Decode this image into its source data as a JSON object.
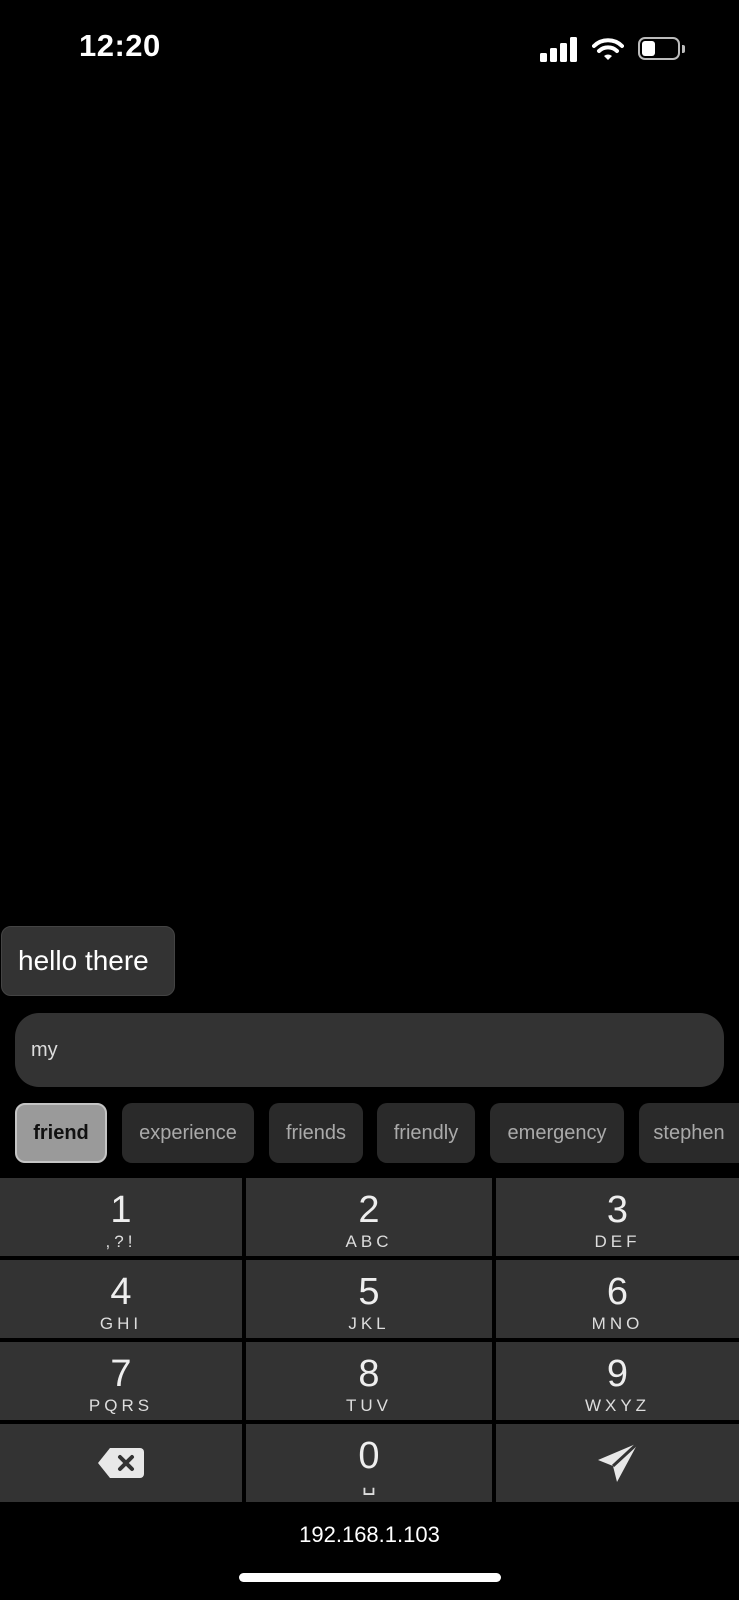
{
  "status_bar": {
    "time": "12:20",
    "icons": [
      "signal-icon",
      "wifi-icon",
      "battery-icon"
    ]
  },
  "conversation": {
    "message": "hello there"
  },
  "input": {
    "value": "my"
  },
  "suggestions": [
    {
      "label": "friend",
      "selected": true
    },
    {
      "label": "experience",
      "selected": false
    },
    {
      "label": "friends",
      "selected": false
    },
    {
      "label": "friendly",
      "selected": false
    },
    {
      "label": "emergency",
      "selected": false
    },
    {
      "label": "stephen",
      "selected": false
    }
  ],
  "keypad": {
    "keys": [
      {
        "digit": "1",
        "letters": ",?!"
      },
      {
        "digit": "2",
        "letters": "ABC"
      },
      {
        "digit": "3",
        "letters": "DEF"
      },
      {
        "digit": "4",
        "letters": "GHI"
      },
      {
        "digit": "5",
        "letters": "JKL"
      },
      {
        "digit": "6",
        "letters": "MNO"
      },
      {
        "digit": "7",
        "letters": "PQRS"
      },
      {
        "digit": "8",
        "letters": "TUV"
      },
      {
        "digit": "9",
        "letters": "WXYZ"
      },
      {
        "icon": "backspace-icon"
      },
      {
        "digit": "0",
        "letters": "␣"
      },
      {
        "icon": "send-icon"
      }
    ]
  },
  "footer": {
    "address": "192.168.1.103"
  },
  "colors": {
    "background": "#000000",
    "key": "#333333",
    "chip": "#2a2a2a",
    "chip_selected": "#9a9a9a"
  }
}
